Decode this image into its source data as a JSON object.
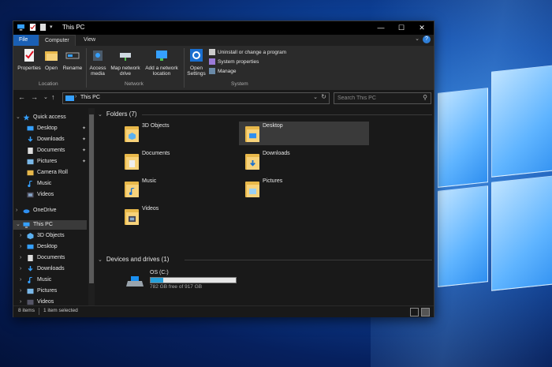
{
  "window": {
    "title": "This PC"
  },
  "ribbon": {
    "tabs": [
      "File",
      "Computer",
      "View"
    ],
    "groups": [
      {
        "label": "Location",
        "buttons": [
          "Properties",
          "Open",
          "Rename"
        ]
      },
      {
        "label": "Network",
        "buttons": [
          "Access media",
          "Map network drive",
          "Add a network location"
        ]
      },
      {
        "label": "System",
        "buttons": [
          "Open Settings"
        ],
        "items": [
          "Uninstall or change a program",
          "System properties",
          "Manage"
        ]
      }
    ]
  },
  "address": {
    "path": "This PC",
    "search_placeholder": "Search This PC"
  },
  "sidebar": {
    "quick_access": "Quick access",
    "quick_items": [
      "Desktop",
      "Downloads",
      "Documents",
      "Pictures",
      "Camera Roll",
      "Music",
      "Videos"
    ],
    "onedrive": "OneDrive",
    "this_pc": "This PC",
    "pc_items": [
      "3D Objects",
      "Desktop",
      "Documents",
      "Downloads",
      "Music",
      "Pictures",
      "Videos"
    ]
  },
  "content": {
    "folders_header": "Folders (7)",
    "folders": [
      "3D Objects",
      "Desktop",
      "Documents",
      "Downloads",
      "Music",
      "Pictures",
      "Videos"
    ],
    "devices_header": "Devices and drives (1)",
    "drive": {
      "name": "OS (C:)",
      "free": "782 GB free of 917 GB",
      "used_fraction": 0.147
    }
  },
  "status": {
    "items": "8 items",
    "selected": "1 item selected"
  },
  "colors": {
    "accent": "#1a5fb4",
    "folder": "#e8b84a",
    "drive_bar": "#26a0da"
  }
}
